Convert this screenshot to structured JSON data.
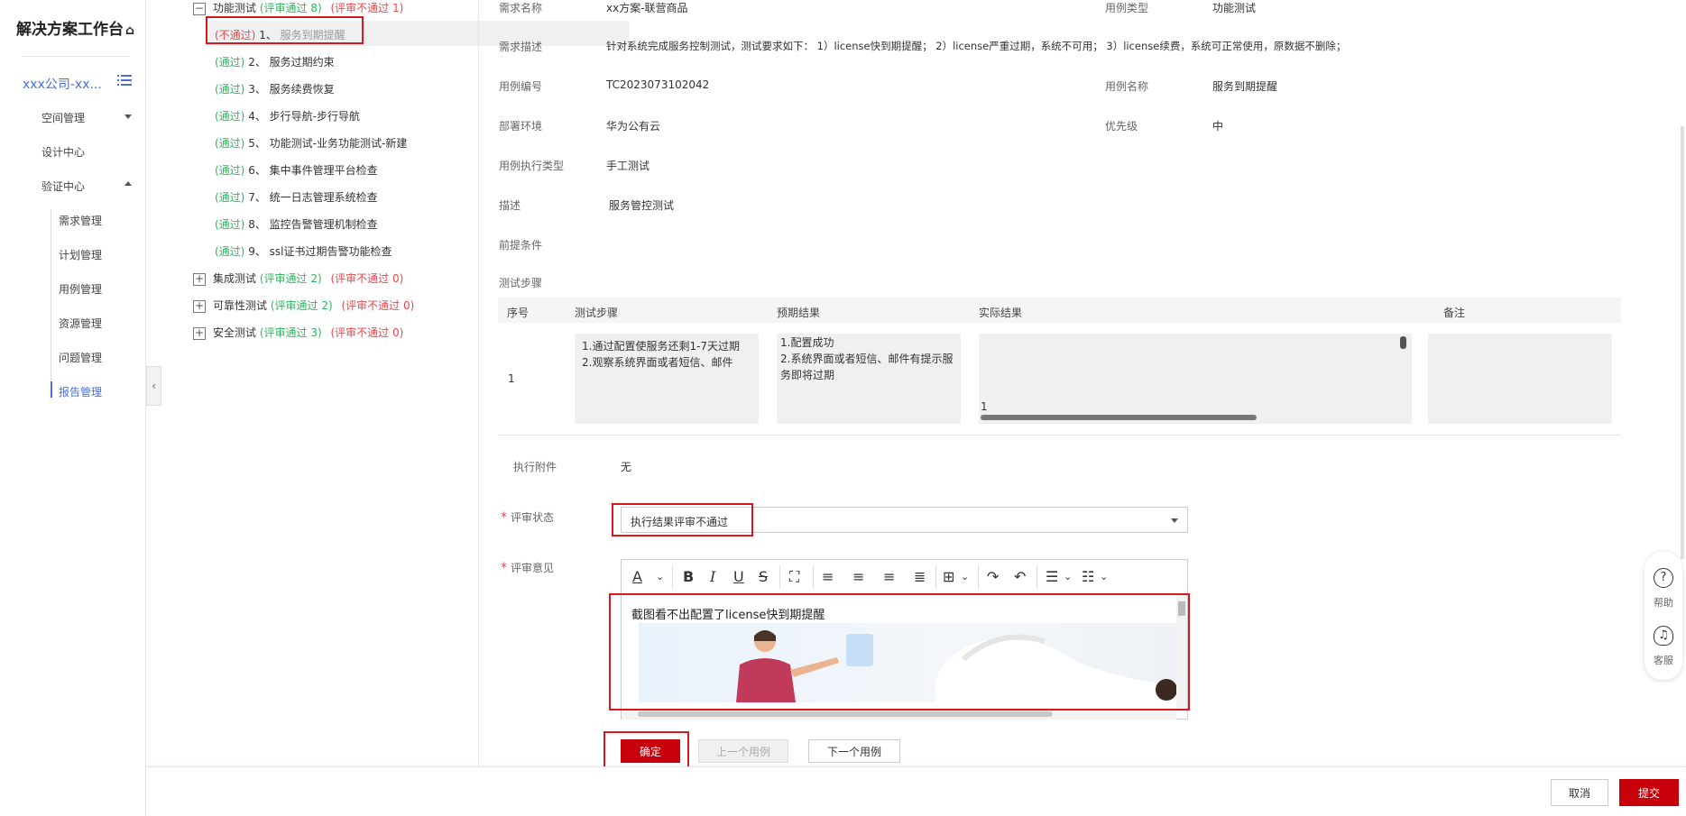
{
  "nav": {
    "brand": "解决方案工作台",
    "company": "xxx公司-xx...",
    "items": [
      {
        "label": "空间管理"
      },
      {
        "label": "设计中心"
      },
      {
        "label": "验证中心"
      }
    ],
    "subitems": [
      {
        "label": "需求管理"
      },
      {
        "label": "计划管理"
      },
      {
        "label": "用例管理"
      },
      {
        "label": "资源管理"
      },
      {
        "label": "问题管理"
      },
      {
        "label": "报告管理"
      }
    ]
  },
  "tree": {
    "func_group": {
      "label": "功能测试",
      "pass": "(评审通过 8)",
      "fail": "(评审不通过 1)"
    },
    "cases": [
      {
        "status": "(不通过)",
        "num": "1、",
        "name": "服务到期提醒"
      },
      {
        "status": "(通过)",
        "num": "2、",
        "name": "服务过期约束"
      },
      {
        "status": "(通过)",
        "num": "3、",
        "name": "服务续费恢复"
      },
      {
        "status": "(通过)",
        "num": "4、",
        "name": "步行导航-步行导航"
      },
      {
        "status": "(通过)",
        "num": "5、",
        "name": "功能测试-业务功能测试-新建"
      },
      {
        "status": "(通过)",
        "num": "6、",
        "name": "集中事件管理平台检查"
      },
      {
        "status": "(通过)",
        "num": "7、",
        "name": "统一日志管理系统检查"
      },
      {
        "status": "(通过)",
        "num": "8、",
        "name": "监控告警管理机制检查"
      },
      {
        "status": "(通过)",
        "num": "9、",
        "name": "ssl证书过期告警功能检查"
      }
    ],
    "groups": [
      {
        "label": "集成测试",
        "pass": "(评审通过 2)",
        "fail": "(评审不通过 0)"
      },
      {
        "label": "可靠性测试",
        "pass": "(评审通过 2)",
        "fail": "(评审不通过 0)"
      },
      {
        "label": "安全测试",
        "pass": "(评审通过 3)",
        "fail": "(评审不通过 0)"
      }
    ]
  },
  "form": {
    "req_name_label": "需求名称",
    "req_name": "xx方案-联营商品",
    "case_type_label": "用例类型",
    "case_type": "功能测试",
    "req_desc_label": "需求描述",
    "req_desc": "针对系统完成服务控制测试，测试要求如下： 1）license快到期提醒； 2）license严重过期，系统不可用； 3）license续费，系统可正常使用，原数据不删除；",
    "case_no_label": "用例编号",
    "case_no": "TC2023073102042",
    "case_name_label": "用例名称",
    "case_name": "服务到期提醒",
    "env_label": "部署环境",
    "env": "华为公有云",
    "priority_label": "优先级",
    "priority": "中",
    "exec_type_label": "用例执行类型",
    "exec_type": "手工测试",
    "desc_label": "描述",
    "desc": "服务管控测试",
    "precond_label": "前提条件",
    "steps_label": "测试步骤",
    "table": {
      "headers": [
        "序号",
        "测试步骤",
        "预期结果",
        "实际结果",
        "备注"
      ],
      "row": {
        "no": "1",
        "steps": [
          "1.通过配置使服务还剩1-7天过期",
          "2.观察系统界面或者短信、邮件"
        ],
        "expected": [
          "1.配置成功",
          "2.系统界面或者短信、邮件有提示服",
          "务即将过期"
        ],
        "actual": "1"
      }
    },
    "attach_label": "执行附件",
    "attach": "无",
    "review_status_label": "评审状态",
    "review_status": "执行结果评审不通过",
    "review_comment_label": "评审意见",
    "review_comment": "截图看不出配置了license快到期提醒"
  },
  "buttons": {
    "confirm": "确定",
    "prev": "上一个用例",
    "next": "下一个用例",
    "cancel": "取消",
    "submit": "提交"
  },
  "help": {
    "help": "帮助",
    "service": "客服"
  },
  "colors": {
    "accent": "#4a6fd8",
    "pass": "#2db55d",
    "fail": "#e5484d",
    "primary": "#c7000b"
  }
}
